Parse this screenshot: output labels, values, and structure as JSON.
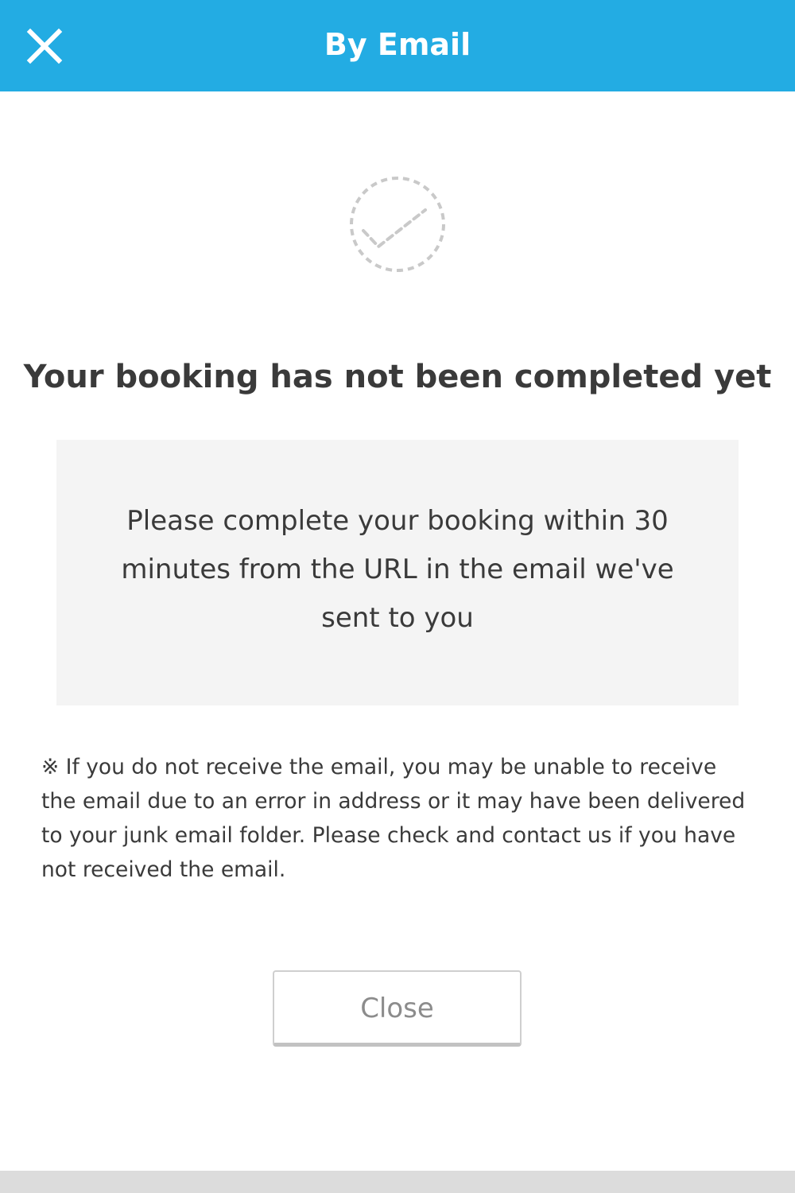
{
  "header": {
    "title": "By Email",
    "close_icon": "close-icon",
    "background_color": "#23ace3"
  },
  "status": {
    "icon": "dashed-check-circle-icon",
    "heading": "Your booking has not been completed yet"
  },
  "notice": {
    "text": "Please complete your booking within 30 minutes from the URL in the email we've sent to you"
  },
  "note": {
    "text": "※ If you do not receive the email, you may be unable to receive the email due to an error in address or it may have been delivered to your junk email folder. Please check and contact us if you have not received the email."
  },
  "actions": {
    "close_label": "Close"
  }
}
